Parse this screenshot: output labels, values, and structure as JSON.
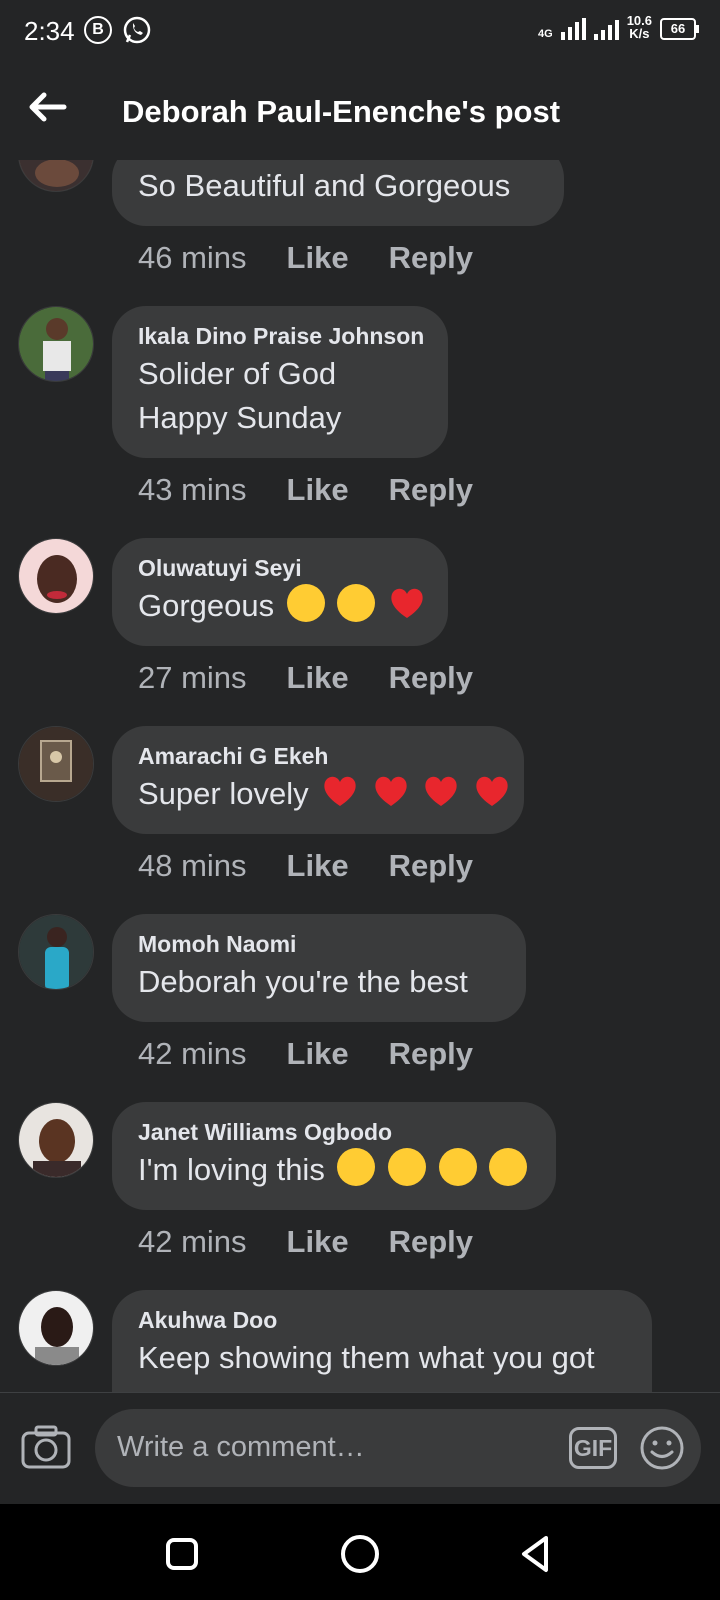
{
  "status_bar": {
    "time": "2:34",
    "icon_a": "B",
    "network": "4G",
    "speed_value": "10.6",
    "speed_unit": "K/s",
    "battery": "66"
  },
  "header": {
    "title": "Deborah Paul-Enenche's post"
  },
  "comments": [
    {
      "name": "",
      "text": "So Beautiful and Gorgeous",
      "time": "46 mins",
      "like": "Like",
      "reply": "Reply"
    },
    {
      "name": "Ikala Dino Praise Johnson",
      "text": "Solider of God",
      "text2": "Happy Sunday",
      "time": "43 mins",
      "like": "Like",
      "reply": "Reply"
    },
    {
      "name": "Oluwatuyi Seyi",
      "text": "Gorgeous",
      "time": "27 mins",
      "like": "Like",
      "reply": "Reply"
    },
    {
      "name": "Amarachi G Ekeh",
      "text": "Super lovely",
      "time": "48 mins",
      "like": "Like",
      "reply": "Reply"
    },
    {
      "name": "Momoh Naomi",
      "text": "Deborah  you're the best",
      "time": "42 mins",
      "like": "Like",
      "reply": "Reply"
    },
    {
      "name": "Janet Williams Ogbodo",
      "text": "I'm  loving this",
      "time": "42 mins",
      "like": "Like",
      "reply": "Reply"
    },
    {
      "name": "Akuhwa Doo",
      "text": "Keep showing them what you got",
      "time": "",
      "like": "",
      "reply": ""
    }
  ],
  "composer": {
    "placeholder": "Write a comment…",
    "gif_label": "GIF"
  },
  "colors": {
    "background": "#242526",
    "bubble": "#3a3b3c",
    "meta_text": "#b0b3b8",
    "heart": "#e8262d"
  }
}
